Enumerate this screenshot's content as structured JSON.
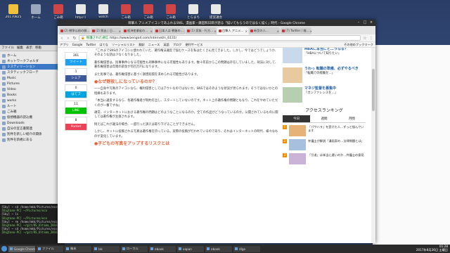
{
  "desktop": {
    "icons": [
      {
        "label": "20170825",
        "color": "#f1c03e",
        "icon": "folder-icon"
      },
      {
        "label": "ホーム",
        "color": "#9aa8bd",
        "icon": "home-folder-icon"
      },
      {
        "label": "ごみ箱",
        "color": "#d04646",
        "icon": "trash-icon"
      },
      {
        "label": "httpsリ",
        "color": "#e8e8e8",
        "icon": "document-icon"
      },
      {
        "label": "watch",
        "color": "#e8e8e8",
        "icon": "document-icon"
      },
      {
        "label": "ごみ箱",
        "color": "#d04646",
        "icon": "trash-icon"
      },
      {
        "label": "ごみ箱",
        "color": "#d04646",
        "icon": "trash-icon"
      },
      {
        "label": "ごみ箱",
        "color": "#d04646",
        "icon": "trash-icon"
      },
      {
        "label": "とらまち",
        "color": "#e8e8e8",
        "icon": "document-icon"
      },
      {
        "label": "提案議会",
        "color": "#e8e8e8",
        "icon": "document-icon"
      }
    ]
  },
  "file_manager": {
    "menu": [
      "ファイル",
      "編集",
      "表示",
      "移動"
    ],
    "items": [
      {
        "label": "ホーム",
        "selected": false
      },
      {
        "label": "ネットワークフォルダ",
        "selected": false
      },
      {
        "label": "ミスティリーション",
        "selected": true
      },
      {
        "label": "スタティックフローテ",
        "selected": false
      },
      {
        "label": "Music",
        "selected": false
      },
      {
        "label": "Pictures",
        "selected": false
      },
      {
        "label": "Video",
        "selected": false
      },
      {
        "label": "Books",
        "selected": false
      },
      {
        "label": "works",
        "selected": false
      },
      {
        "label": "ルート",
        "selected": false
      },
      {
        "label": "ごみ箱",
        "selected": false
      },
      {
        "label": "仮想機器の読込機",
        "selected": false
      },
      {
        "label": "Downloads",
        "selected": false
      },
      {
        "label": "自分の宣言書関連",
        "selected": false
      },
      {
        "label": "別件を新しい紹介の関係",
        "selected": false
      },
      {
        "label": "別件を新規にある",
        "selected": false
      }
    ]
  },
  "terminal": {
    "lines": [
      {
        "text": "[Sky] ~ cd /home/mkk/Pictures/eco",
        "green": false
      },
      {
        "text": "[Bigtano-PC] ~/Pictures/eco",
        "green": true
      },
      {
        "text": "[Sky] ~ ls",
        "green": false
      },
      {
        "text": "[Bigtano-PC] ~/Pictures/eco",
        "green": true
      },
      {
        "text": "[Sky] ~ rm /home/mkk/Pictures/eco",
        "green": false
      },
      {
        "text": "[Bigtano-PC] ~/git/RS_Ultima_2016",
        "green": true
      },
      {
        "text": "[Sky] ~ cd /home/mkk/Pictures/eco",
        "green": false
      },
      {
        "text": "[Bigtano-PC] ~/git/RS_Ultima_2016",
        "green": true
      }
    ]
  },
  "right_window": {
    "lines": [
      "",
      "",
      "",
      "",
      "",
      "",
      "",
      "",
      "",
      "",
      "",
      "",
      "",
      "",
      "",
      "",
      "",
      "",
      "",
      "",
      "",
      "",
      "",
      "",
      "",
      "",
      "",
      "",
      ""
    ]
  },
  "chrome": {
    "window_title": "目撃人 アニメアイコンであふれるSNS、漫画家・藤田和日郎が語る「描いてもらうのではなく描く」時代 - Google Chrome",
    "tabs": [
      {
        "label": "(2) 戦争以前の開…",
        "active": false
      },
      {
        "label": "(2) 脱出 | 日…",
        "active": false
      },
      {
        "label": "経済産業省の…",
        "active": false
      },
      {
        "label": "日本人は 戦後の…",
        "active": false
      },
      {
        "label": "(1) 家族 - 行方…",
        "active": false
      },
      {
        "label": "目撃人 アニメ…",
        "active": true
      },
      {
        "label": "新型の人…",
        "active": false
      },
      {
        "label": "(7) Twitter / 検…",
        "active": false
      }
    ],
    "url_secure": "保護された通信",
    "url": "https://www.bengo4.com/internet/n_6131/",
    "bookmarks": [
      "アプリ",
      "Google",
      "Twitter",
      "はてな",
      "ソーシャルリスト",
      "翻訳",
      "ニュース",
      "英語",
      "ブログ",
      "便利サービス"
    ],
    "bookmarks_other": "その他のブックマーク"
  },
  "article": {
    "share_counts": [
      {
        "count": "361",
        "label": "ツイート",
        "color": "#1da1f2"
      },
      {
        "count": "1",
        "label": "シェア",
        "color": "#3b5998"
      },
      {
        "count": "0",
        "label": "はてブ",
        "color": "#00a4de"
      },
      {
        "count": "11",
        "label": "LINE",
        "color": "#00c300"
      },
      {
        "count": "8",
        "label": "Pocket",
        "color": "#ee4056"
      }
    ],
    "paragraphs": [
      "「これまでSNSのアイコンに使われていた、著作権法違反で悩むケースを私はたくさん見てきました。しかし、今ではどうでしょうか、そのような話は少なくなりました。",
      "著作権侵害は、民事事件になる可能性も刑事事件になる可能性もあります。数十年前からこの問題は存在していました。刑法に対して、著作権侵害は年間の罰金が何百万円になります。",
      "また民事では、著作権侵害に基づく損害賠償を求められる可能性があります。"
    ],
    "heading1": "●なぜ野放しになっているのか？",
    "paragraphs2": [
      "一一自身や写真のアイコンなら、権利侵害としてはアウトなのではないか。SNSではそのような状況が見られます。そうではないかとの指摘もあります。",
      "「本当に違反するなら、各著作権者が制約を出し、スタートしていないのです。ネット上の著作権の問題ともなり、これをやめていただくのが一番ですね」",
      "通常、インターネットにおける著作権の問題はどのようなことになるのか。全ての作品がどうなっているのか。公開されているものに関しては著作権が主張されます。",
      "例えばこれが違法の場合、一度行った訴えは取り下げることができません。"
    ],
    "paragraph3": "しかし、ネットに投稿される写真は著作権を持っている。実際の投稿が行われているのであり、それはインターネットの時代、様々なものが変化しています。",
    "heading2": "●子どもの写真をアップするリスクとは"
  },
  "sidebar": {
    "items": [
      {
        "title": "HBAに本当にど…うなる？",
        "text": "「HBAについて知りたい」"
      },
      {
        "title": "うわっ 転職の準備、必ずやるべき",
        "text": "「転職での経験を…」"
      },
      {
        "title": "マネジ監督を募集中",
        "text": "「カンファレンスを…」"
      }
    ],
    "ranking_title": "アクセスランキング",
    "ranking_tabs": [
      "今日",
      "週間",
      "月間"
    ],
    "rankings": [
      {
        "num": "1",
        "text": "「パワハラ」を受けた人…ずっと悩んでいます"
      },
      {
        "num": "2",
        "text": "弁護士が解説「漫画家の…法律問題とは」"
      },
      {
        "num": "3",
        "text": "「引退」は本当に遅いのか…弁護士の意見"
      }
    ]
  },
  "taskbar": {
    "tasks": [
      {
        "label": "Google Chrome",
        "active": true
      },
      {
        "label": "ファイル",
        "active": false
      },
      {
        "label": "端末",
        "active": false
      },
      {
        "label": "Isk",
        "active": false
      },
      {
        "label": "ローカル",
        "active": false
      },
      {
        "label": "ebook",
        "active": false
      },
      {
        "label": "xapan",
        "active": false
      },
      {
        "label": "ebook",
        "active": false
      },
      {
        "label": "dlgo",
        "active": false
      }
    ],
    "clock_time": "01:28",
    "clock_date": "2017年8月26日 土曜日"
  }
}
